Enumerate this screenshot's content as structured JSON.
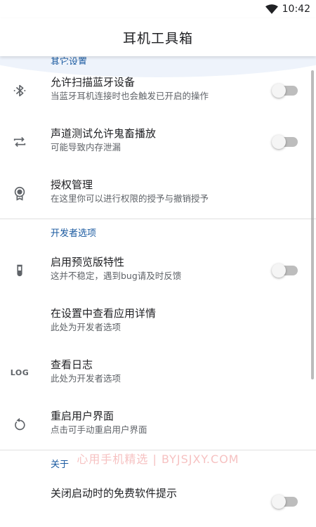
{
  "status_bar": {
    "time": "10:42",
    "wifi_icon": "wifi-icon"
  },
  "app_bar": {
    "title": "耳机工具箱"
  },
  "sections": {
    "other": {
      "header": "其它设置"
    },
    "developer": {
      "header": "开发者选项"
    },
    "about": {
      "header": "关于"
    }
  },
  "other_items": [
    {
      "title": "允许扫描蓝牙设备",
      "subtitle": "当蓝牙耳机连接时也会触发已开启的操作",
      "icon": "bluetooth-scan-icon",
      "toggle": false
    },
    {
      "title": "声道测试允许鬼畜播放",
      "subtitle": "可能导致内存泄漏",
      "icon": "repeat-icon",
      "toggle": false
    },
    {
      "title": "授权管理",
      "subtitle": "在这里你可以进行权限的授予与撤销授予",
      "icon": "badge-icon"
    }
  ],
  "developer_items": [
    {
      "title": "启用预览版特性",
      "subtitle": "这并不稳定，遇到bug请及时反馈",
      "icon": "test-tube-icon",
      "toggle": false
    },
    {
      "title": "在设置中查看应用详情",
      "subtitle": "此处为开发者选项"
    },
    {
      "title": "查看日志",
      "subtitle": "此处为开发者选项",
      "icon_text": "LOG"
    },
    {
      "title": "重启用户界面",
      "subtitle": "点击可手动重启用户界面",
      "icon": "restart-icon"
    }
  ],
  "about_items": [
    {
      "title": "关闭启动时的免费软件提示",
      "toggle": false
    }
  ],
  "watermark": "心用手机精选 | BYJSJXY.COM",
  "colors": {
    "accent": "#1a5aa0",
    "switch_off_track": "#bdbdbd",
    "switch_off_knob": "#f5f5f5"
  }
}
